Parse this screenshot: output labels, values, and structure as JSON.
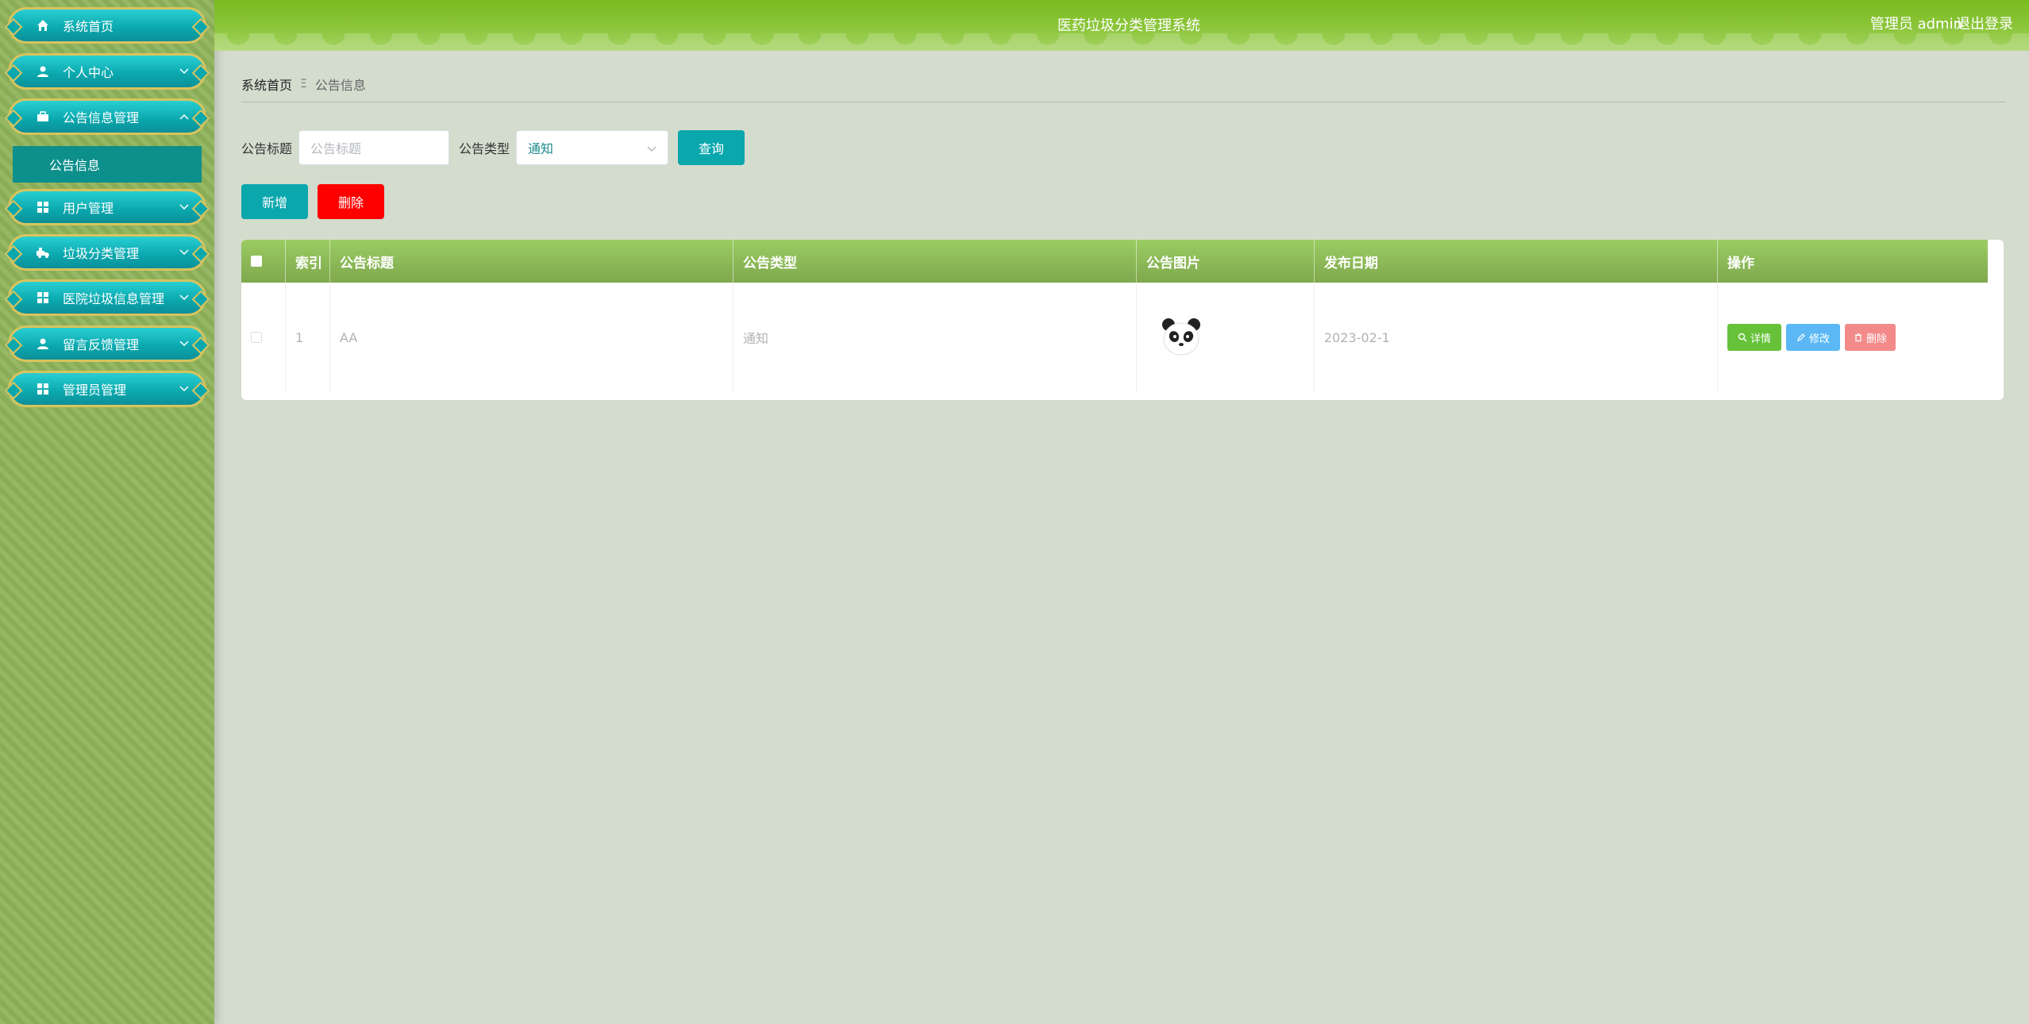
{
  "app": {
    "title": "医药垃圾分类管理系统",
    "user": "管理员 admin",
    "logout": "退出登录"
  },
  "sidebar": {
    "items": [
      {
        "label": "系统首页",
        "icon": "home-icon"
      },
      {
        "label": "个人中心",
        "icon": "person-icon"
      },
      {
        "label": "公告信息管理",
        "icon": "briefcase-icon"
      },
      {
        "label": "用户管理",
        "icon": "grid-icon"
      },
      {
        "label": "垃圾分类管理",
        "icon": "recycle-truck-icon"
      },
      {
        "label": "医院垃圾信息管理",
        "icon": "grid-icon"
      },
      {
        "label": "留言反馈管理",
        "icon": "person-icon"
      },
      {
        "label": "管理员管理",
        "icon": "grid-icon"
      }
    ],
    "submenu": {
      "label": "公告信息"
    }
  },
  "breadcrumb": {
    "home": "系统首页",
    "separator": "Ξ",
    "current": "公告信息"
  },
  "search": {
    "title_label": "公告标题",
    "title_placeholder": "公告标题",
    "type_label": "公告类型",
    "type_value": "通知",
    "query_button": "查询"
  },
  "actions": {
    "add": "新增",
    "delete": "删除"
  },
  "table": {
    "headers": [
      "索引",
      "公告标题",
      "公告类型",
      "公告图片",
      "发布日期",
      "操作"
    ],
    "rows": [
      {
        "index": "1",
        "title": "AA",
        "type": "通知",
        "image": "panda-icon",
        "date": "2023-02-1",
        "ops": {
          "detail": "详情",
          "edit": "修改",
          "delete": "删除"
        }
      }
    ]
  },
  "colors": {
    "header": "#8cc63c",
    "accent": "#0aa7ad",
    "danger": "#ff0000",
    "detail": "#67c23a",
    "edit": "#5bb8f5",
    "delete_soft": "#f28a8a"
  }
}
